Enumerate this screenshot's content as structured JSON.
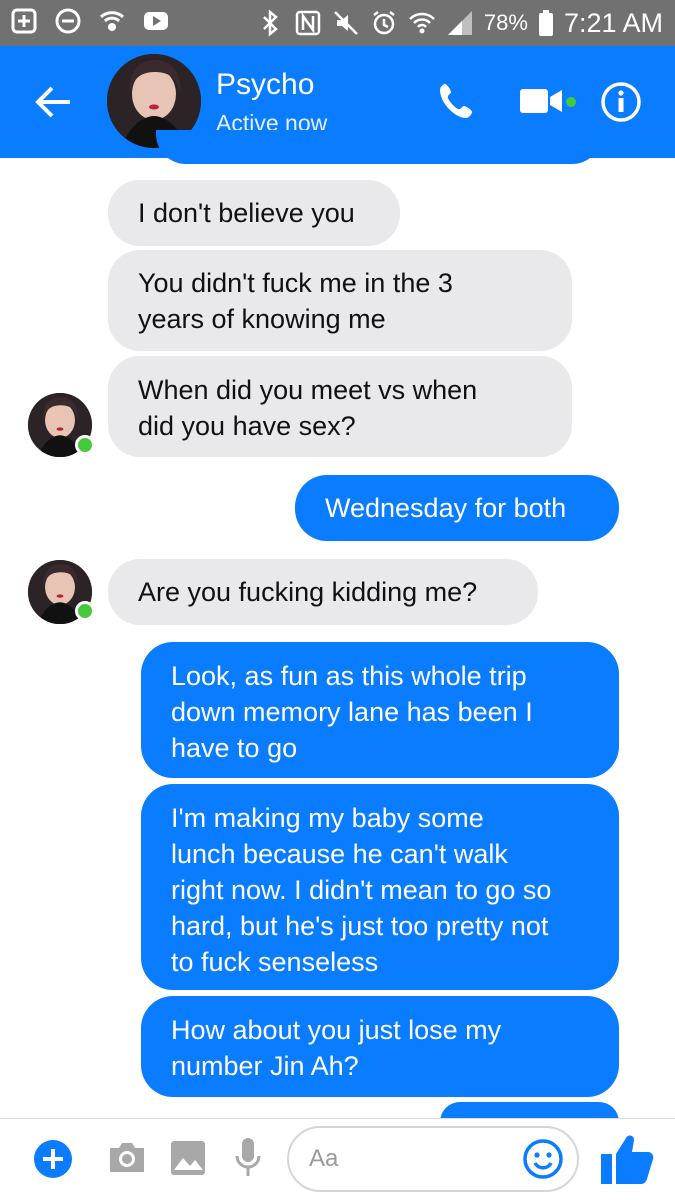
{
  "status_bar": {
    "battery_percent": "78%",
    "time": "7:21 AM"
  },
  "header": {
    "contact_name": "Psycho",
    "contact_status": "Active now",
    "icons": [
      "back-arrow-icon",
      "phone-icon",
      "video-camera-icon",
      "info-icon"
    ]
  },
  "messages": [
    {
      "from": "them",
      "text": "I don't believe you"
    },
    {
      "from": "them",
      "text": "You didn't fuck me in the 3\nyears of knowing me"
    },
    {
      "from": "them",
      "text": "When did you meet vs when\ndid you have sex?"
    },
    {
      "from": "me",
      "text": "Wednesday for both"
    },
    {
      "from": "them",
      "text": "Are you fucking kidding me?"
    },
    {
      "from": "me",
      "text": "Look, as fun as this whole trip\ndown memory lane has been I\nhave to go"
    },
    {
      "from": "me",
      "text": "I'm making my baby some\nlunch because he can't walk\nright now. I didn't mean to go so\nhard, but he's just too pretty not\nto fuck senseless"
    },
    {
      "from": "me",
      "text": "How about you just lose my\nnumber Jin Ah?"
    }
  ],
  "composer": {
    "placeholder": "Aa",
    "icons": [
      "plus-icon",
      "camera-icon",
      "image-icon",
      "microphone-icon",
      "emoji-icon",
      "thumbs-up-icon"
    ]
  },
  "colors": {
    "brand_blue": "#0a7cff",
    "incoming_bubble": "#e9e9eb",
    "online_green": "#45c93a",
    "status_bar": "#717171"
  }
}
